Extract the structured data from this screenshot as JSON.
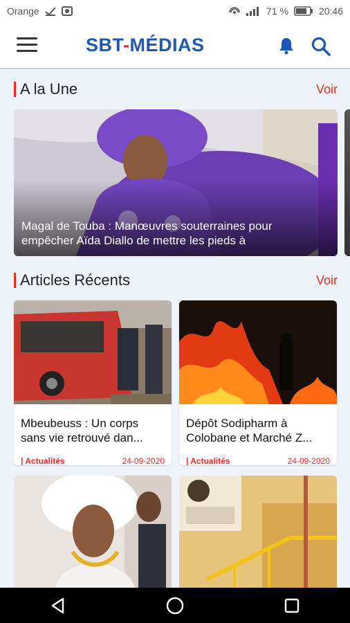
{
  "status_bar": {
    "carrier": "Orange",
    "battery": "71 %",
    "time": "20:46"
  },
  "app_bar": {
    "logo_part1": "SBT",
    "logo_dash": "-",
    "logo_part2": "MÉDIAS",
    "brand_color": "#1e56b3",
    "accent_color": "#e52b2b"
  },
  "featured": {
    "section_title": "A la Une",
    "voir_label": "Voir",
    "headline": "Magal de Touba : Manœuvres souterraines pour empêcher Aïda Diallo de mettre les pieds à"
  },
  "recent": {
    "section_title": "Articles Récents",
    "voir_label": "Voir",
    "articles": [
      {
        "title": "Mbeubeuss : Un corps sans vie retrouvé dan...",
        "category": "| Actualités",
        "date": "24-09-2020"
      },
      {
        "title": "Dépôt Sodipharm à Colobane et Marché Z...",
        "category": "| Actualités",
        "date": "24-09-2020"
      }
    ]
  },
  "icons": {
    "menu": "hamburger-icon",
    "notifications": "bell-icon",
    "search": "search-icon",
    "back": "back-triangle-icon",
    "home": "home-circle-icon",
    "recents": "recents-square-icon"
  }
}
